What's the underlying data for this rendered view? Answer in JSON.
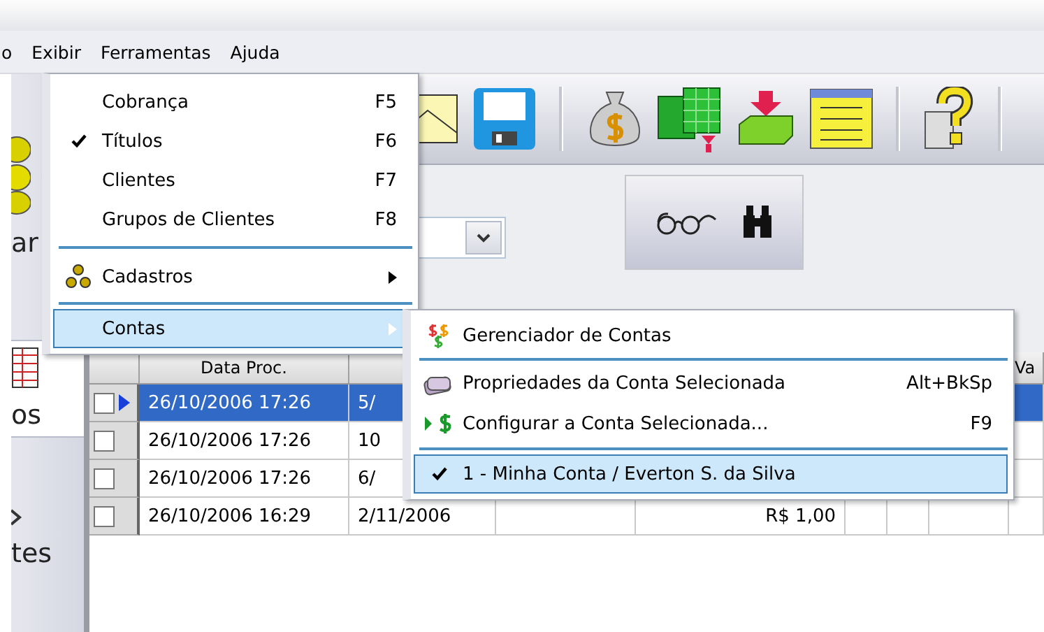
{
  "menubar": [
    {
      "label": "o"
    },
    {
      "label": "Exibir"
    },
    {
      "label": "Ferramentas"
    },
    {
      "label": "Ajuda"
    }
  ],
  "sidebar": {
    "items": [
      {
        "label": "ar",
        "selected": false
      },
      {
        "label": "os",
        "selected": true
      },
      {
        "label": "tes",
        "selected": false
      }
    ]
  },
  "grid": {
    "columns": [
      {
        "label": "Data Proc."
      },
      {
        "label": "Va"
      }
    ],
    "rows": [
      {
        "selected": true,
        "checked": false,
        "data_proc": "26/10/2006 17:26",
        "column_2": "5/"
      },
      {
        "selected": false,
        "checked": false,
        "data_proc": "26/10/2006 17:26",
        "column_2": "10"
      },
      {
        "selected": false,
        "checked": false,
        "data_proc": "26/10/2006 17:26",
        "column_2": "6/"
      },
      {
        "selected": false,
        "checked": false,
        "data_proc": "26/10/2006 16:29",
        "column_2": "2/11/2006",
        "column_4": "R$ 1,00"
      }
    ]
  },
  "view_menu": {
    "items": [
      {
        "kind": "item",
        "label": "Cobrança",
        "shortcut": "F5",
        "checked": false,
        "selected": false
      },
      {
        "kind": "item",
        "label": "Títulos",
        "shortcut": "F6",
        "checked": true,
        "selected": false
      },
      {
        "kind": "item",
        "label": "Clientes",
        "shortcut": "F7",
        "checked": false,
        "selected": false
      },
      {
        "kind": "item",
        "label": "Grupos de Clientes",
        "shortcut": "F8",
        "checked": false,
        "selected": false
      },
      {
        "kind": "separator"
      },
      {
        "kind": "submenu",
        "label": "Cadastros",
        "selected": false
      },
      {
        "kind": "separator"
      },
      {
        "kind": "submenu",
        "label": "Contas",
        "selected": true
      }
    ]
  },
  "accounts_submenu": {
    "items": [
      {
        "kind": "item",
        "label": "Gerenciador de Contas",
        "checked": false,
        "selected": false
      },
      {
        "kind": "separator"
      },
      {
        "kind": "item",
        "label": "Propriedades da Conta Selecionada",
        "shortcut": "Alt+BkSp",
        "checked": false,
        "selected": false
      },
      {
        "kind": "item",
        "label": "Configurar a Conta Selecionada...",
        "shortcut": "F9",
        "checked": false,
        "selected": false
      },
      {
        "kind": "separator"
      },
      {
        "kind": "item",
        "label": "1 - Minha Conta / Everton S. da Silva",
        "checked": true,
        "selected": true
      }
    ]
  }
}
